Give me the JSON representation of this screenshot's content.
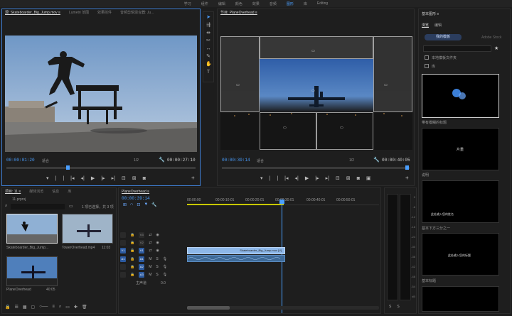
{
  "topbar": {
    "items": [
      "学习",
      "组件",
      "编辑",
      "颜色",
      "效果",
      "音频",
      "图形",
      "库",
      "Editing"
    ],
    "active_index": 6
  },
  "source": {
    "tabs": [
      "源: Skateboarder_Big_Jump.mov ≡",
      "Lumetri 范围",
      "效果控件",
      "音频剪辑混合器: Ju..."
    ],
    "timecode": "00:00:01:20",
    "fit": "适合",
    "ratio": "1/2",
    "duration": "00:00:27:10"
  },
  "program": {
    "tabs": [
      "节目: PlaneOverhead ≡"
    ],
    "timecode": "00:00:39:14",
    "fit": "适合",
    "ratio": "1/2",
    "duration": "00:00:40:05"
  },
  "project": {
    "tabs": [
      "项目: 11 ≡",
      "媒体浏览",
      "信息",
      "库"
    ],
    "folder": "11.prproj",
    "selection_info": "1 项已选择，共 3 项",
    "items": [
      {
        "name": "Skateboarder_Big_Jump...",
        "duration": ""
      },
      {
        "name": "TowerOverhead.mp4",
        "duration": "11:03"
      },
      {
        "name": "PlaneOverhead",
        "duration": "40:05"
      }
    ]
  },
  "timeline": {
    "tab": "PlaneOverhead ≡",
    "timecode": "00:00:39:14",
    "ruler": [
      "00:00:00",
      "00:00:10:01",
      "00:00:20:01",
      "00:00:30:01",
      "00:00:40:01",
      "00:00:50:01"
    ],
    "video_tracks": [
      "V3",
      "V2",
      "V1"
    ],
    "audio_tracks": [
      "A1",
      "A2",
      "A3"
    ],
    "master_label": "主声道",
    "master_value": "0.0",
    "clip_label": "Skateboarder_Big_Jump.mov [V]"
  },
  "essential": {
    "title": "基本图形 ≡",
    "tabs": [
      "浏览",
      "编辑"
    ],
    "button_my": "我的模板",
    "button_adobe": "Adobe Stock",
    "checkbox_local": "本地模板文件夹",
    "checkbox_lib": "库",
    "cards": [
      {
        "label": "带有模糊的标题",
        "text": ""
      },
      {
        "label": "说明",
        "text": "片重"
      },
      {
        "label": "基本下方三分之一",
        "text": "此处输入您的姓名"
      },
      {
        "label": "基本标题",
        "text": "此处输入您的标题"
      }
    ]
  },
  "meters": {
    "ticks": [
      "0",
      "-6",
      "-12",
      "-18",
      "-24",
      "-30",
      "-36",
      "-42",
      "-48",
      "-54",
      "dB"
    ]
  },
  "colors": {
    "accent": "#4a9fff",
    "clip": "#8db7e8",
    "audio_clip": "#3e6a98"
  }
}
